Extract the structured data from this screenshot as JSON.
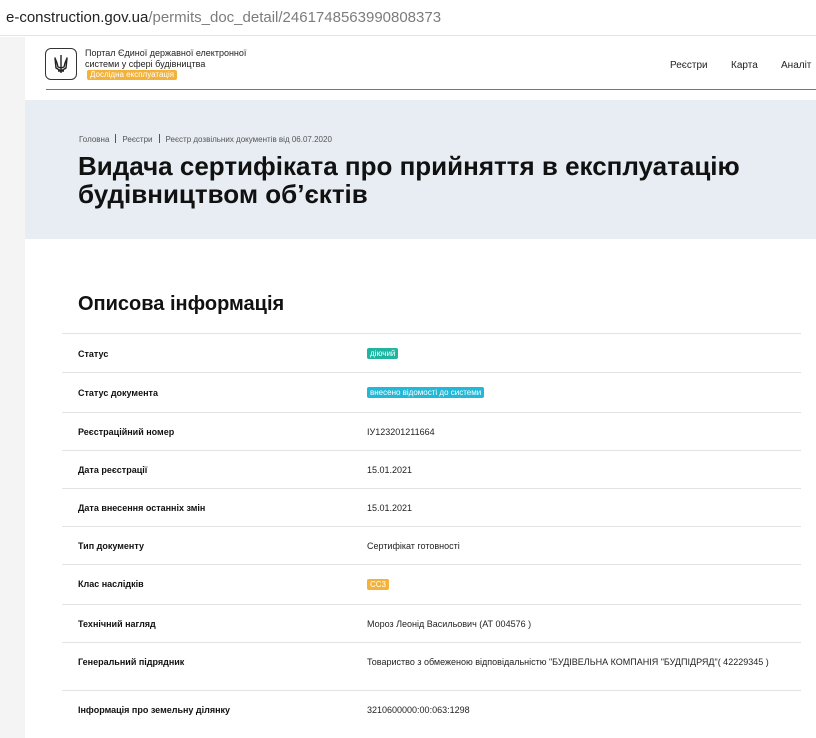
{
  "browser": {
    "url_host": "e-construction.gov.ua",
    "url_path": "/permits_doc_detail/2461748563990808373"
  },
  "header": {
    "portal_name": "Портал Єдиної державної електронної системи у сфері будівництва",
    "pilot_badge": "Дослідна експлуатація",
    "nav": [
      "Реєстри",
      "Карта",
      "Аналіт"
    ]
  },
  "breadcrumb": [
    "Головна",
    "Реєстри",
    "Реєстр дозвільних документів від 06.07.2020"
  ],
  "page_title_line1": "Видача сертифіката про прийняття в експлуатацію",
  "page_title_line2": "будівництвом об’єктів",
  "section": {
    "title": "Описова інформація",
    "rows": [
      {
        "label": "Статус",
        "value": "діючий",
        "type": "tag",
        "tag_color": "#1fb5a0"
      },
      {
        "label": "Статус документа",
        "value": "внесено відомості до системи",
        "type": "tag",
        "tag_color": "#22b8d8"
      },
      {
        "label": "Реєстраційний номер",
        "value": "ІУ123201211664",
        "type": "text"
      },
      {
        "label": "Дата реєстрації",
        "value": "15.01.2021",
        "type": "text"
      },
      {
        "label": "Дата внесення останніх змін",
        "value": "15.01.2021",
        "type": "text"
      },
      {
        "label": "Тип документу",
        "value": "Сертифікат готовності",
        "type": "text"
      },
      {
        "label": "Клас наслідків",
        "value": "СС3",
        "type": "tag",
        "tag_color": "#f3b23a"
      },
      {
        "label": "Технічний нагляд",
        "value": "Мороз Леонід Васильович (АТ 004576 )",
        "type": "text"
      },
      {
        "label": "Генеральний підрядник",
        "value": "Товариство з обмеженою відповідальністю \"БУДІВЕЛЬНА КОМПАНІЯ \"БУДПІДРЯД\"( 42229345 )",
        "type": "text"
      },
      {
        "label": "Інформація про земельну ділянку",
        "value": "3210600000:00:063:1298",
        "type": "text"
      }
    ]
  }
}
